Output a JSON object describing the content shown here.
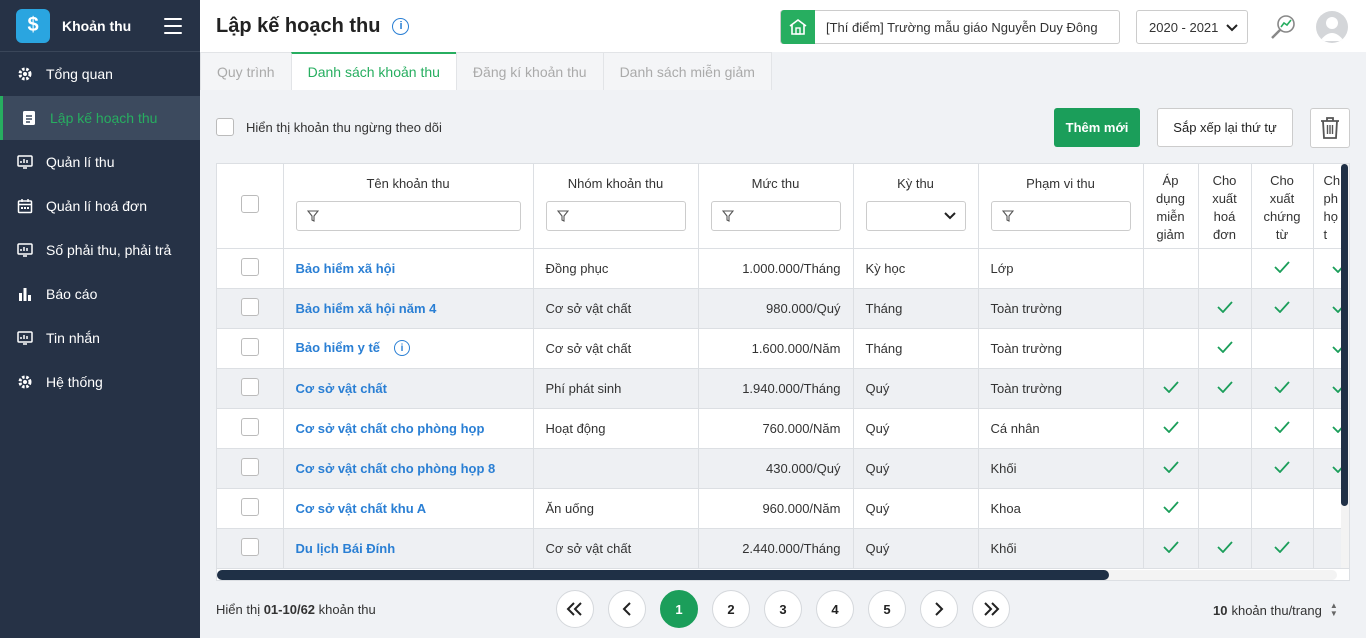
{
  "app": {
    "brand": "Khoản thu"
  },
  "sidebar": {
    "items": [
      {
        "label": "Tổng quan",
        "icon": "gear-icon"
      },
      {
        "label": "Lập kế hoạch thu",
        "icon": "document-icon"
      },
      {
        "label": "Quản lí thu",
        "icon": "monitor-icon"
      },
      {
        "label": "Quản lí hoá đơn",
        "icon": "calendar-icon"
      },
      {
        "label": "Số phải thu, phải trả",
        "icon": "monitor-icon"
      },
      {
        "label": "Báo cáo",
        "icon": "bar-chart-icon"
      },
      {
        "label": "Tin nhắn",
        "icon": "monitor-icon"
      },
      {
        "label": "Hệ thống",
        "icon": "gear-icon"
      }
    ],
    "active_index": 1
  },
  "header": {
    "title": "Lập kế hoạch thu",
    "school": "[Thí điểm] Trường mẫu giáo Nguyễn Duy Đông",
    "year": "2020 - 2021"
  },
  "tabs": [
    "Quy trình",
    "Danh sách khoản thu",
    "Đăng kí khoản thu",
    "Danh sách miễn giảm"
  ],
  "active_tab": 1,
  "toolbar": {
    "show_stopped": "Hiển thị khoản thu ngừng theo dõi",
    "add_label": "Thêm mới",
    "sort_label": "Sắp xếp lại thứ tự"
  },
  "table": {
    "columns": {
      "name": "Tên khoản thu",
      "group": "Nhóm khoản thu",
      "amount": "Mức thu",
      "period": "Kỳ thu",
      "scope": "Phạm vi thu",
      "discount": [
        "Áp",
        "dụng",
        "miễn",
        "giảm"
      ],
      "invoice": [
        "Cho",
        "xuất",
        "hoá",
        "đơn"
      ],
      "voucher": [
        "Cho",
        "xuất",
        "chứng",
        "từ"
      ],
      "extra": [
        "Ch",
        "ph",
        "họ",
        "t"
      ]
    },
    "rows": [
      {
        "name": "Bảo hiểm xã hội",
        "group": "Đồng phục",
        "amount": "1.000.000/Tháng",
        "period": "Kỳ học",
        "scope": "Lớp",
        "discount": false,
        "invoice": false,
        "voucher": true,
        "extra": true,
        "info": false
      },
      {
        "name": "Bảo hiểm xã hội năm 4",
        "group": "Cơ sở vật chất",
        "amount": "980.000/Quý",
        "period": "Tháng",
        "scope": "Toàn trường",
        "discount": false,
        "invoice": true,
        "voucher": true,
        "extra": true,
        "info": false
      },
      {
        "name": "Bảo hiểm y tế",
        "group": "Cơ sở vật chất",
        "amount": "1.600.000/Năm",
        "period": "Tháng",
        "scope": "Toàn trường",
        "discount": false,
        "invoice": true,
        "voucher": false,
        "extra": true,
        "info": true
      },
      {
        "name": "Cơ sở vật chất",
        "group": "Phí phát sinh",
        "amount": "1.940.000/Tháng",
        "period": "Quý",
        "scope": "Toàn trường",
        "discount": true,
        "invoice": true,
        "voucher": true,
        "extra": true,
        "info": false
      },
      {
        "name": "Cơ sở vật chất cho phòng họp",
        "group": "Hoạt động",
        "amount": "760.000/Năm",
        "period": "Quý",
        "scope": "Cá nhân",
        "discount": true,
        "invoice": false,
        "voucher": true,
        "extra": true,
        "info": false
      },
      {
        "name": "Cơ sở vật chất cho phòng họp 8",
        "group": "",
        "amount": "430.000/Quý",
        "period": "Quý",
        "scope": "Khối",
        "discount": true,
        "invoice": false,
        "voucher": true,
        "extra": true,
        "info": false
      },
      {
        "name": "Cơ sở vật chất khu A",
        "group": "Ăn uống",
        "amount": "960.000/Năm",
        "period": "Quý",
        "scope": "Khoa",
        "discount": true,
        "invoice": false,
        "voucher": false,
        "extra": false,
        "info": false
      },
      {
        "name": "Du lịch Bái Đính",
        "group": "Cơ sở vật chất",
        "amount": "2.440.000/Tháng",
        "period": "Quý",
        "scope": "Khối",
        "discount": true,
        "invoice": true,
        "voucher": true,
        "extra": false,
        "info": false
      }
    ]
  },
  "pagination": {
    "summary_prefix": "Hiển thị",
    "range": "01-10/62",
    "summary_suffix": "khoản thu",
    "pages": [
      "1",
      "2",
      "3",
      "4",
      "5"
    ],
    "current": "1",
    "per_page": "10",
    "per_page_suffix": "khoản thu/trang"
  },
  "colors": {
    "accent": "#1b9e5a",
    "sidebar": "#263246",
    "link": "#2a7fd4"
  }
}
